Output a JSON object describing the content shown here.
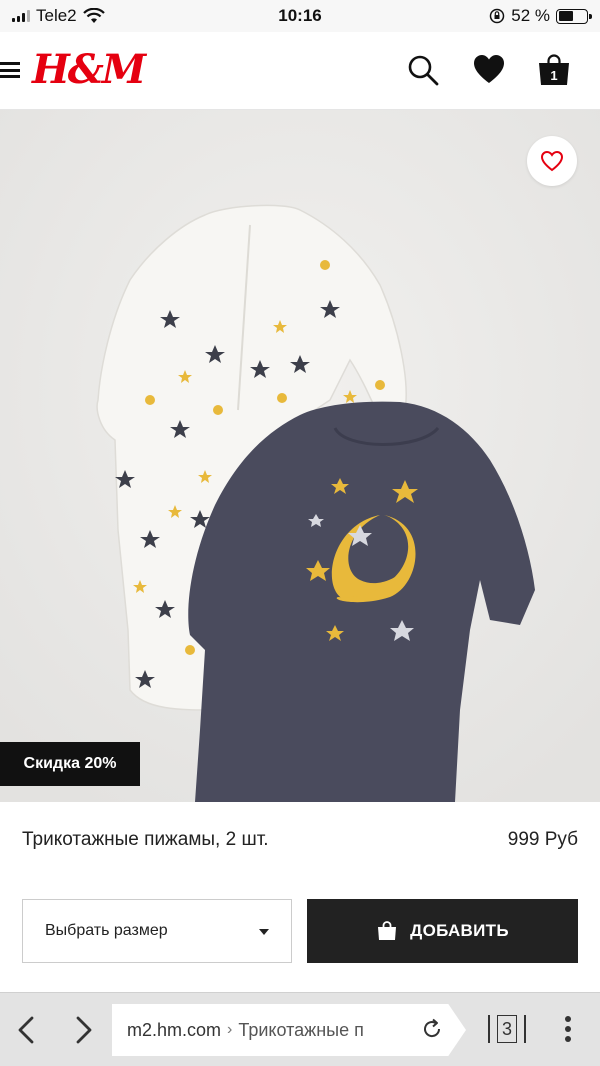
{
  "status_bar": {
    "carrier": "Tele2",
    "time": "10:16",
    "battery": "52 %",
    "battery_level": 0.52
  },
  "header": {
    "logo": "H&M",
    "icons": [
      "menu-icon",
      "search-icon",
      "heart-icon",
      "bag-icon"
    ],
    "bag_count": "1",
    "brand_color": "#e50010"
  },
  "product": {
    "discount_badge": "Скидка 20%",
    "name": "Трикотажные пижамы, 2 шт.",
    "price": "999 Руб",
    "size_select_label": "Выбрать размер",
    "add_button_label": "ДОБАВИТЬ"
  },
  "browser": {
    "domain": "m2.hm.com",
    "separator": "›",
    "page_title": "Трикотажные п",
    "tab_count": "3"
  }
}
